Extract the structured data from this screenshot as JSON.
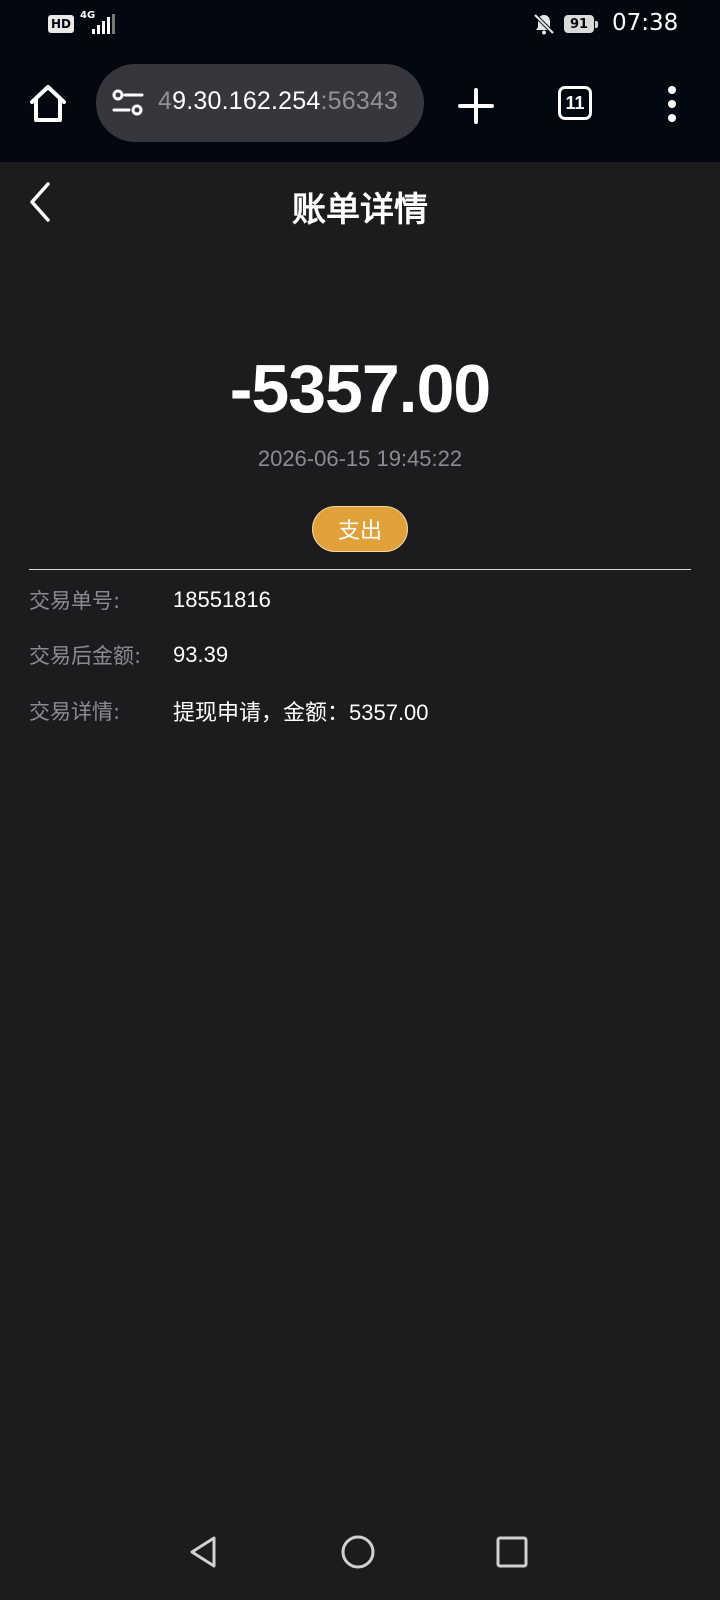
{
  "status_bar": {
    "hd_label": "HD",
    "network_label": "4G",
    "battery_level": "91",
    "time": "07:38"
  },
  "browser": {
    "url_prefix": "4",
    "url_host": "9.30.162.254",
    "url_port": ":56343",
    "tab_count": "11"
  },
  "page": {
    "title": "账单详情"
  },
  "transaction": {
    "amount": "-5357.00",
    "datetime": "2026-06-15 19:45:22",
    "type_badge": "支出",
    "details": [
      {
        "label": "交易单号:",
        "value": "18551816"
      },
      {
        "label": "交易后金额:",
        "value": "93.39"
      },
      {
        "label": "交易详情:",
        "value": "提现申请，金额：5357.00"
      }
    ]
  },
  "colors": {
    "background": "#1c1c1e",
    "badge": "#e0a13a",
    "muted_text": "#8b8b95"
  }
}
